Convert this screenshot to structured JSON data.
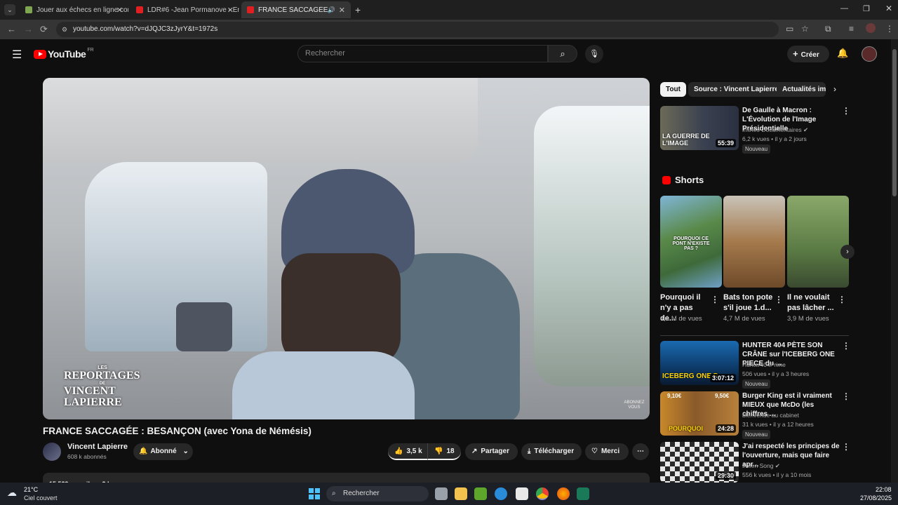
{
  "browser": {
    "tabs": [
      {
        "title": "Jouer aux échecs en ligne con..."
      },
      {
        "title": "LDR#6 -Jean Pormanove - Enqu..."
      },
      {
        "title": "FRANCE SACCAGÉE : BESAN..."
      }
    ],
    "url": "youtube.com/watch?v=dJQJC3zJyrY&t=1972s"
  },
  "yt": {
    "logo_text": "YouTube",
    "region": "FR",
    "search_placeholder": "Rechercher",
    "create_label": "Créer",
    "video": {
      "title": "FRANCE SACCAGÉE : BESANÇON (avec Yona de Némésis)",
      "overlay_brand_1": "LES",
      "overlay_brand_2": "REPORTAGES",
      "overlay_brand_3": "DE",
      "overlay_brand_4": "VINCENT LAPIERRE",
      "overlay_sub": "ABONNEZ VOUS",
      "channel": "Vincent Lapierre",
      "subs": "608 k abonnés",
      "subscribed_label": "Abonné",
      "likes": "3,5 k",
      "dislikes": "18",
      "share": "Partager",
      "download": "Télécharger",
      "thanks": "Merci",
      "desc_stats": "15 529 vues  il y a 2 heures"
    },
    "chips": [
      "Tout",
      "Source : Vincent Lapierre",
      "Actualités im..."
    ],
    "recs": [
      {
        "title": "De Gaulle à Macron : L'Évolution de l'Image Présidentielle",
        "channel": "imineo Documentaires",
        "stats": "6,2 k vues • il y a 2 jours",
        "badge": "Nouveau",
        "duration": "55:39",
        "thumb_text": "LA GUERRE DE L'IMAGE"
      },
      {
        "title": "HUNTER 404 PÈTE SON CRÂNE sur l'ICEBERG ONE PIECE du ...",
        "channel": "Hunter404Prime",
        "stats": "506 vues • il y a 3 heures",
        "badge": "Nouveau",
        "duration": "3:07:12",
        "thumb_text": "ICEBERG ONE P"
      },
      {
        "title": "Burger King est il vraiment MIEUX que McDo (les chiffres ...",
        "channel": "bienvenue au cabinet",
        "stats": "31 k vues • il y a 12 heures",
        "badge": "Nouveau",
        "duration": "24:28",
        "thumb_text": "POURQUOI",
        "price_left": "9,10€",
        "price_right": "9,50€"
      },
      {
        "title": "J'ai respecté les principes de l'ouverture, mais que faire apr...",
        "channel": "Julien Song",
        "stats": "556 k vues • il y a 10 mois",
        "badge": "",
        "duration": "29:30",
        "thumb_text": ""
      }
    ],
    "shorts_heading": "Shorts",
    "shorts": [
      {
        "title": "Pourquoi il n'y a pas de...",
        "views": "4,1 M de vues",
        "thumb_text": "POURQUOI CE PONT N'EXISTE PAS ?"
      },
      {
        "title": "Bats ton pote s'il joue 1.d...",
        "views": "4,7 M de vues",
        "thumb_text": ""
      },
      {
        "title": "Il ne voulait pas lâcher ...",
        "views": "3,9 M de vues",
        "thumb_text": ""
      }
    ]
  },
  "taskbar": {
    "temp": "21°C",
    "weather": "Ciel couvert",
    "search": "Rechercher",
    "time": "22:08",
    "date": "27/08/2025"
  }
}
